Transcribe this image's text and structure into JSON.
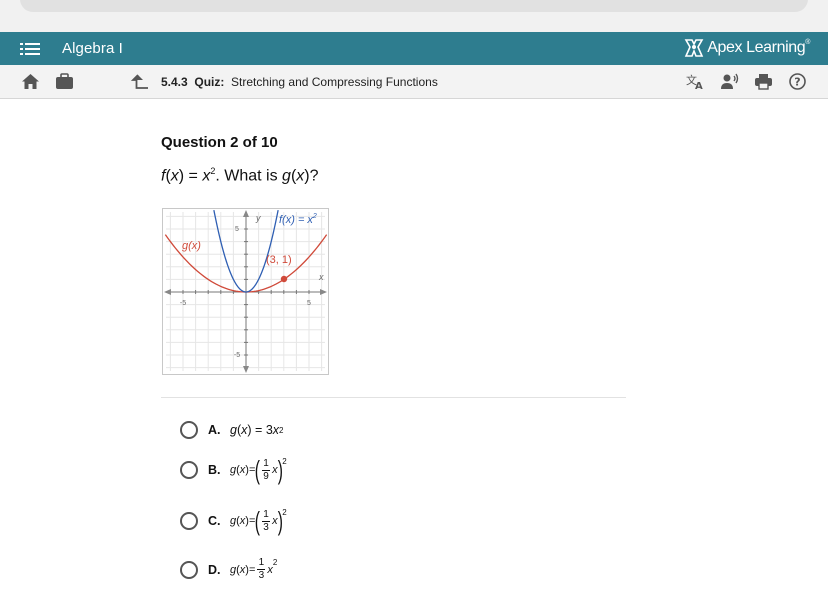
{
  "app": {
    "course_title": "Algebra I",
    "brand_name": "Apex Learning",
    "brand_tm": "®",
    "primary_color": "#2e7d8f"
  },
  "toolbar": {
    "lesson_number": "5.4.3",
    "lesson_type": "Quiz:",
    "lesson_title": "Stretching and Compressing Functions",
    "icons": [
      "home-icon",
      "briefcase-icon",
      "back-arrow-icon",
      "translate-icon",
      "read-aloud-icon",
      "print-icon",
      "help-icon"
    ]
  },
  "question": {
    "counter": "Question 2 of 10",
    "prompt_f": "f",
    "prompt_x": "x",
    "prompt_eq": " = ",
    "prompt_exp": "2",
    "prompt_tail": ". What is ",
    "prompt_g": "g",
    "prompt_end": "?"
  },
  "graph": {
    "y_label": "y",
    "x_label": "x",
    "tick_pos": "5",
    "tick_neg": "-5",
    "f_label": "f(x) = x",
    "f_exp": "2",
    "g_label": "g(x)",
    "point_label": "(3, 1)",
    "f_color": "#2f5fb3",
    "g_color": "#d04a3a",
    "xlim": [
      -6.3,
      6.3
    ],
    "ylim": [
      -6.3,
      6.3
    ]
  },
  "choices": [
    {
      "letter": "A.",
      "selected": false
    },
    {
      "letter": "B.",
      "selected": false
    },
    {
      "letter": "C.",
      "selected": false
    },
    {
      "letter": "D.",
      "selected": false
    }
  ],
  "math": {
    "g": "g",
    "x": "x",
    "eq": "=",
    "a_coef": "3",
    "sq": "2",
    "one": "1",
    "nine": "9",
    "three": "3",
    "lparen": "(",
    "rparen": ")"
  }
}
